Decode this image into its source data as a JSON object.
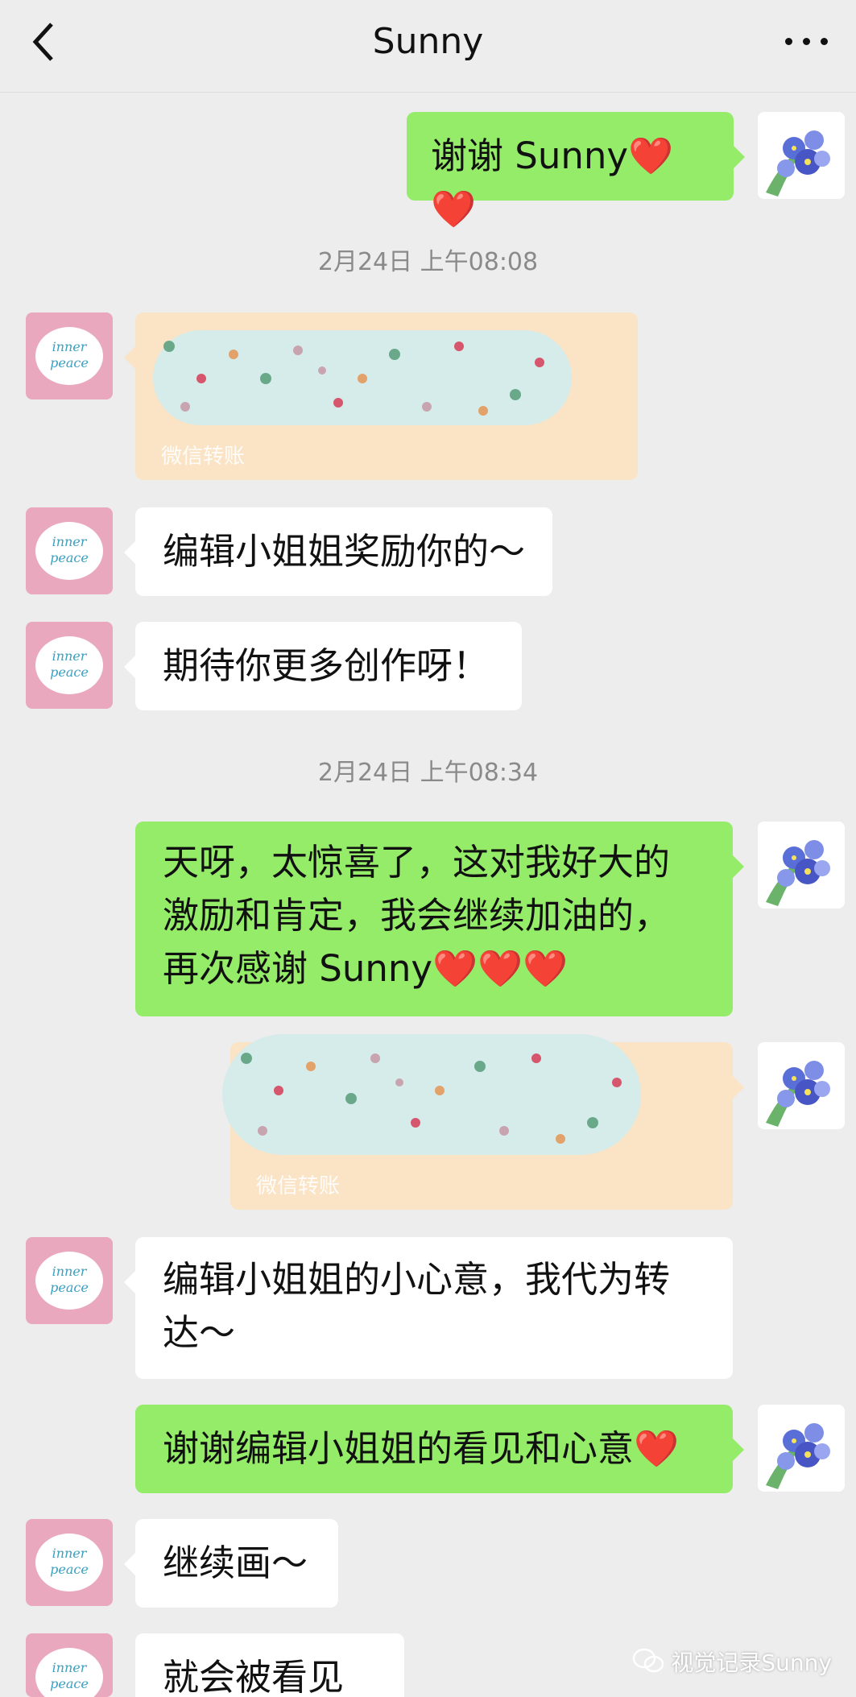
{
  "header": {
    "title": "Sunny"
  },
  "timestamps": [
    "2月24日 上午08:08",
    "2月24日 上午08:34"
  ],
  "messages": {
    "m1": "谢谢 Sunny❤️❤️",
    "m2_transfer_label": "微信转账",
    "m3": "编辑小姐姐奖励你的～",
    "m4": "期待你更多创作呀！",
    "m5": "天呀，太惊喜了，这对我好大的激励和肯定，我会继续加油的，再次感谢 Sunny❤️❤️❤️",
    "m6_transfer_label": "微信转账",
    "m7": "编辑小姐姐的小心意，我代为转达～",
    "m8": "谢谢编辑小姐姐的看见和心意❤️",
    "m9": "继续画～",
    "m10": "就会被看见～"
  },
  "avatars": {
    "other_text": "inner peace"
  },
  "watermark": {
    "text": "视觉记录Sunny"
  },
  "colors": {
    "sent_bubble": "#95ec69",
    "received_bubble": "#ffffff",
    "transfer": "#fbe3c5",
    "background": "#ededed"
  }
}
